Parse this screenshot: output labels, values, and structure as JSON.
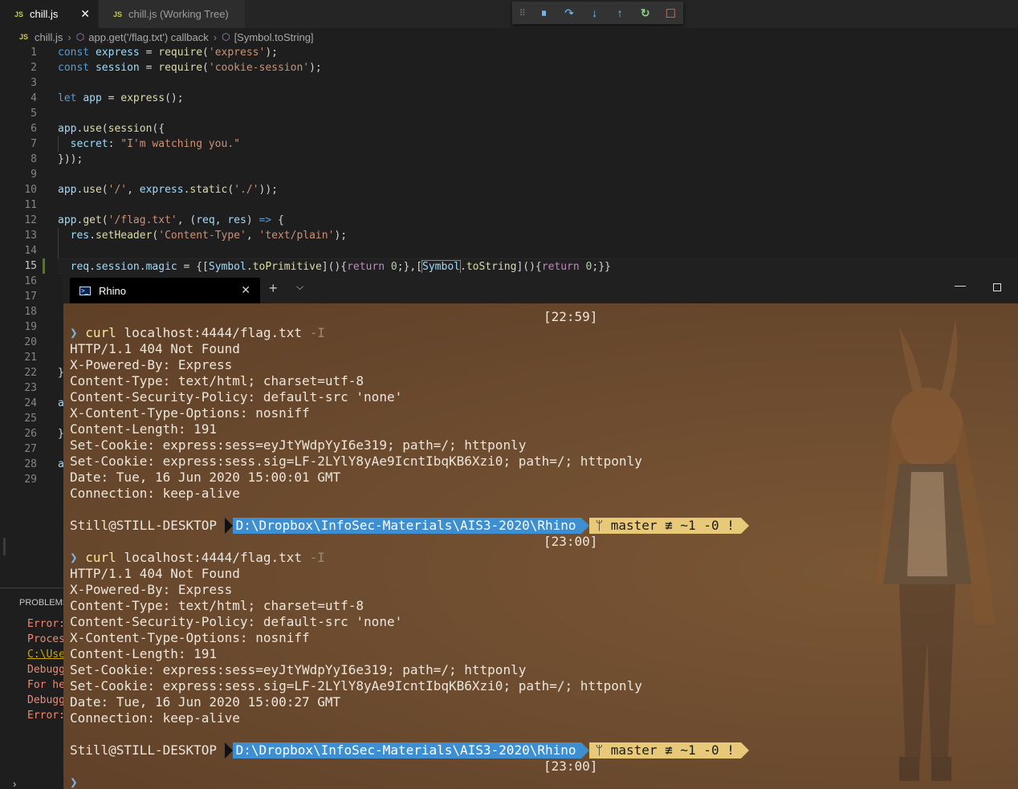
{
  "editor": {
    "tabs": [
      {
        "badge": "JS",
        "label": "chill.js",
        "close": "✕"
      },
      {
        "badge": "JS",
        "label": "chill.js (Working Tree)"
      }
    ],
    "breadcrumb": {
      "file_badge": "JS",
      "file": "chill.js",
      "sep": "›",
      "callback": "app.get('/flag.txt') callback",
      "symbol": "[Symbol.toString]"
    },
    "line_numbers": [
      "1",
      "2",
      "3",
      "4",
      "5",
      "6",
      "7",
      "8",
      "9",
      "10",
      "11",
      "12",
      "13",
      "14",
      "15",
      "16",
      "17",
      "18",
      "19",
      "20",
      "21",
      "22",
      "23",
      "24",
      "25",
      "26",
      "27",
      "28",
      "29"
    ],
    "code": {
      "l1": [
        "const",
        " ",
        "express",
        " = ",
        "require",
        "(",
        "'express'",
        ");"
      ],
      "l2": [
        "const",
        " ",
        "session",
        " = ",
        "require",
        "(",
        "'cookie-session'",
        ");"
      ],
      "l4": [
        "let",
        " ",
        "app",
        " = ",
        "express",
        "();"
      ],
      "l6": [
        "app",
        ".",
        "use",
        "(",
        "session",
        "({"
      ],
      "l7": [
        "  ",
        "secret",
        ": ",
        "\"I'm watching you.\""
      ],
      "l8": [
        "}));"
      ],
      "l10": [
        "app",
        ".",
        "use",
        "(",
        "'/'",
        ", ",
        "express",
        ".",
        "static",
        "(",
        "'./'",
        "));"
      ],
      "l12": [
        "app",
        ".",
        "get",
        "(",
        "'/flag.txt'",
        ", (",
        "req",
        ", ",
        "res",
        ") ",
        "=>",
        " {"
      ],
      "l13": [
        "  ",
        "res",
        ".",
        "setHeader",
        "(",
        "'Content-Type'",
        ", ",
        "'text/plain'",
        ");"
      ],
      "l15": [
        "  ",
        "req",
        ".",
        "session",
        ".",
        "magic",
        " = {[",
        "Symbol",
        ".",
        "toPrimitive",
        "](){",
        "return",
        " ",
        "0",
        ";},[",
        "Symbol",
        ".",
        "toString",
        "](){",
        "return",
        " ",
        "0",
        ";}}"
      ],
      "l22_frag": "}",
      "l24_frag": "a",
      "l26_frag": "}",
      "l28_frag": "a"
    }
  },
  "debug_toolbar": {
    "grip": "⠿",
    "pause": "⏸",
    "step_over": "↷",
    "step_into": "↓",
    "step_out": "↑",
    "restart": "↻",
    "stop": "□"
  },
  "panel": {
    "title": "PROBLEMS",
    "lines": [
      {
        "text": "Error:",
        "color": "#f48771"
      },
      {
        "text": "Proces",
        "color": "#f48771"
      },
      {
        "text": "C:\\Use",
        "color": "#cca700"
      },
      {
        "text": "Debugg",
        "color": "#f48771"
      },
      {
        "text": "For he",
        "color": "#f48771"
      },
      {
        "text": "Debugg",
        "color": "#f48771"
      },
      {
        "text": "Error:",
        "color": "#f48771"
      }
    ],
    "chevron": "›"
  },
  "terminal": {
    "tab_title": "Rhino",
    "tab_icon": ">_",
    "tab_close": "✕",
    "add": "+",
    "dropdown": "⌵",
    "minimize": "—",
    "blocks": [
      {
        "time": "[22:59]",
        "prompt_arrow": "❯",
        "cmd": "curl",
        "args": " localhost:4444/flag.txt ",
        "flag": "-I",
        "output": [
          "HTTP/1.1 404 Not Found",
          "X-Powered-By: Express",
          "Content-Type: text/html; charset=utf-8",
          "Content-Security-Policy: default-src 'none'",
          "X-Content-Type-Options: nosniff",
          "Content-Length: 191",
          "Set-Cookie: express:sess=eyJtYWdpYyI6e319; path=/; httponly",
          "Set-Cookie: express:sess.sig=LF-2LYlY8yAe9IcntIbqKB6Xzi0; path=/; httponly",
          "Date: Tue, 16 Jun 2020 15:00:01 GMT",
          "Connection: keep-alive"
        ]
      },
      {
        "time": "[23:00]",
        "prompt_arrow": "❯",
        "cmd": "curl",
        "args": " localhost:4444/flag.txt ",
        "flag": "-I",
        "output": [
          "HTTP/1.1 404 Not Found",
          "X-Powered-By: Express",
          "Content-Type: text/html; charset=utf-8",
          "Content-Security-Policy: default-src 'none'",
          "X-Content-Type-Options: nosniff",
          "Content-Length: 191",
          "Set-Cookie: express:sess=eyJtYWdpYyI6e319; path=/; httponly",
          "Set-Cookie: express:sess.sig=LF-2LYlY8yAe9IcntIbqKB6Xzi0; path=/; httponly",
          "Date: Tue, 16 Jun 2020 15:00:27 GMT",
          "Connection: keep-alive"
        ]
      }
    ],
    "prompt": {
      "user": "Still@STILL-DESKTOP ",
      "path": "D:\\Dropbox\\InfoSec-Materials\\AIS3-2020\\Rhino",
      "git": "ᛘ master ≢ ~1 -0 !"
    },
    "final_time": "[23:00]",
    "final_arrow": "❯",
    "colors": {
      "background": "#6b4a2e",
      "path_segment": "#3d8fd1",
      "git_segment": "#e8c879",
      "command": "#f6e89a",
      "arrow": "#7ab4f0"
    }
  }
}
